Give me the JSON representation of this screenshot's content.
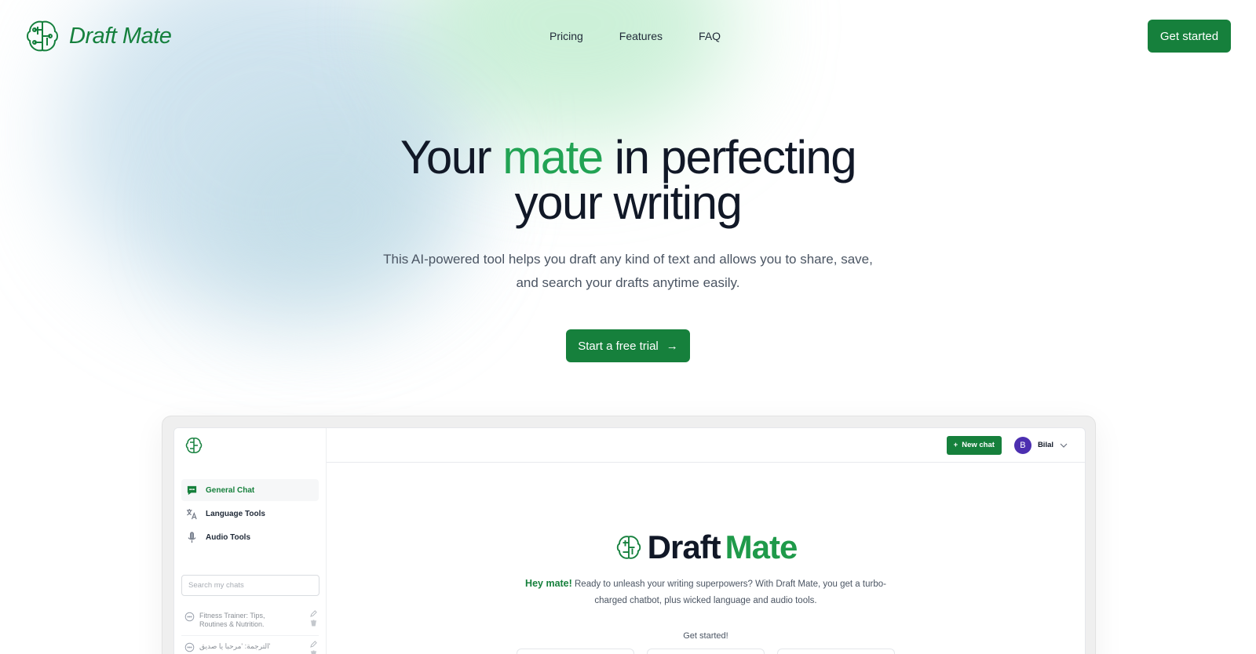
{
  "brand": {
    "name": "Draft Mate",
    "logo_icon": "brain-circuit-icon",
    "color": "#15803d"
  },
  "nav": {
    "items": [
      "Pricing",
      "Features",
      "FAQ"
    ]
  },
  "header": {
    "cta_label": "Get started"
  },
  "hero": {
    "title_part1": "Your ",
    "title_accent": "mate",
    "title_part2": " in perfecting",
    "title_line2": "your writing",
    "subtitle_line1": "This AI-powered tool helps you draft any kind of text and allows you to share, save,",
    "subtitle_line2": "and search your drafts anytime easily.",
    "cta_label": "Start a free trial",
    "cta_arrow": "→"
  },
  "app_preview": {
    "sidebar": {
      "menu": [
        {
          "label": "General Chat",
          "icon": "chat-bubble-icon",
          "active": true
        },
        {
          "label": "Language Tools",
          "icon": "translate-icon",
          "active": false
        },
        {
          "label": "Audio Tools",
          "icon": "microphone-icon",
          "active": false
        }
      ],
      "search_placeholder": "Search my chats",
      "chats": [
        {
          "line1": "Fitness Trainer: Tips,",
          "line2": "Routines & Nutrition."
        },
        {
          "line1": "الترجمة: 'مرحبا يا صديق'",
          "line2": ""
        }
      ]
    },
    "topbar": {
      "new_chat_label": "New chat",
      "user_initial": "B",
      "user_name": "Bilal"
    },
    "content": {
      "brand_word1": "Draft",
      "brand_word2": "Mate",
      "hey": "Hey mate!",
      "welcome_text": "Ready to unleash your writing superpowers? With Draft Mate, you get a turbo-charged chatbot, plus wicked language and audio tools.",
      "get_started": "Get started!"
    }
  },
  "colors": {
    "primary": "#16803c",
    "accent_text": "#22a354",
    "avatar": "#4c2fb0"
  }
}
